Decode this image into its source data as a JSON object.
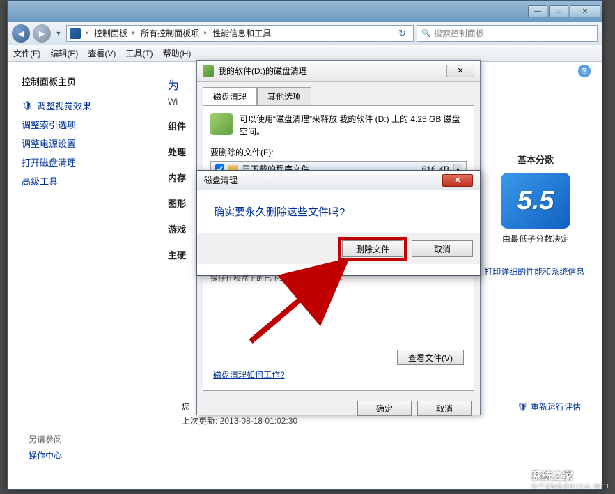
{
  "breadcrumb": {
    "p1": "控制面板",
    "p2": "所有控制面板项",
    "p3": "性能信息和工具"
  },
  "search": {
    "placeholder": "搜索控制面板"
  },
  "menu": {
    "file": "文件(F)",
    "edit": "编辑(E)",
    "view": "查看(V)",
    "tools": "工具(T)",
    "help": "帮助(H)"
  },
  "sidebar": {
    "home": "控制面板主页",
    "visual": "调整视觉效果",
    "index": "调整索引选项",
    "power": "调整电源设置",
    "disk": "打开磁盘清理",
    "adv": "高级工具",
    "seeAlsoHdr": "另请参阅",
    "actionCenter": "操作中心"
  },
  "main": {
    "titlePrefix": "为",
    "sub": "Wi",
    "rows": {
      "comp": "组件",
      "proc": "处理",
      "mem": "内存",
      "graph": "图形",
      "game": "游戏",
      "disk": "主硬"
    },
    "infoLine": "您",
    "lastUpdate": "上次更新: 2013-08-18 01:02:30"
  },
  "right": {
    "header": "基本分数",
    "score": "5.5",
    "note": "由最低子分数决定",
    "printLink": "打印详细的性能和系统信息",
    "rerun": "重新运行评估"
  },
  "dlg1": {
    "title": "我的软件(D:)的磁盘清理",
    "tab1": "磁盘清理",
    "tab2": "其他选项",
    "info": "可以使用“磁盘清理”来释放 我的软件 (D:) 上的 4.25 GB 磁盘空间。",
    "filesToDelete": "要删除的文件(F):",
    "item1": "已下载的程序文件",
    "item1size": "616 KB",
    "stored": "探仔仕咬盆上的已下载的程序文件夹中。",
    "viewFiles": "查看文件(V)",
    "howWorks": "磁盘清理如何工作?",
    "ok": "确定",
    "cancel": "取消"
  },
  "dlg2": {
    "title": "磁盘清理",
    "msg": "确实要永久删除这些文件吗?",
    "delete": "删除文件",
    "cancel": "取消"
  },
  "watermark": {
    "name": "系统之家",
    "sub": "XITONGZHIJIA.NET"
  }
}
